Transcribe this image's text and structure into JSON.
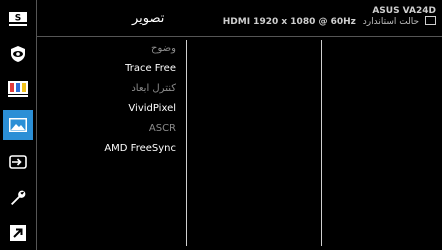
{
  "header": {
    "title": "تصویر",
    "model": "ASUS VA24D",
    "mode": "حالت استاندارد",
    "signal": "HDMI 1920 x 1080 @ 60Hz"
  },
  "sidebar": {
    "items": [
      {
        "icon": "splendid-s-icon"
      },
      {
        "icon": "eye-care-icon"
      },
      {
        "icon": "color-bars-icon"
      },
      {
        "icon": "image-icon",
        "active": true
      },
      {
        "icon": "input-select-icon"
      },
      {
        "icon": "wrench-icon"
      },
      {
        "icon": "shortcut-arrow-icon"
      }
    ]
  },
  "menu": {
    "items": [
      {
        "label": "وضوح",
        "enabled": false
      },
      {
        "label": "Trace Free",
        "enabled": true
      },
      {
        "label": "کنترل ابعاد",
        "enabled": false
      },
      {
        "label": "VividPixel",
        "enabled": true
      },
      {
        "label": "ASCR",
        "enabled": false
      },
      {
        "label": "AMD FreeSync",
        "enabled": true
      }
    ]
  },
  "colors": {
    "background": "#000000",
    "accent": "#2b8fd6",
    "text_enabled": "#ffffff",
    "text_disabled": "#8c8c8c",
    "lines": "#cfcfcf"
  }
}
